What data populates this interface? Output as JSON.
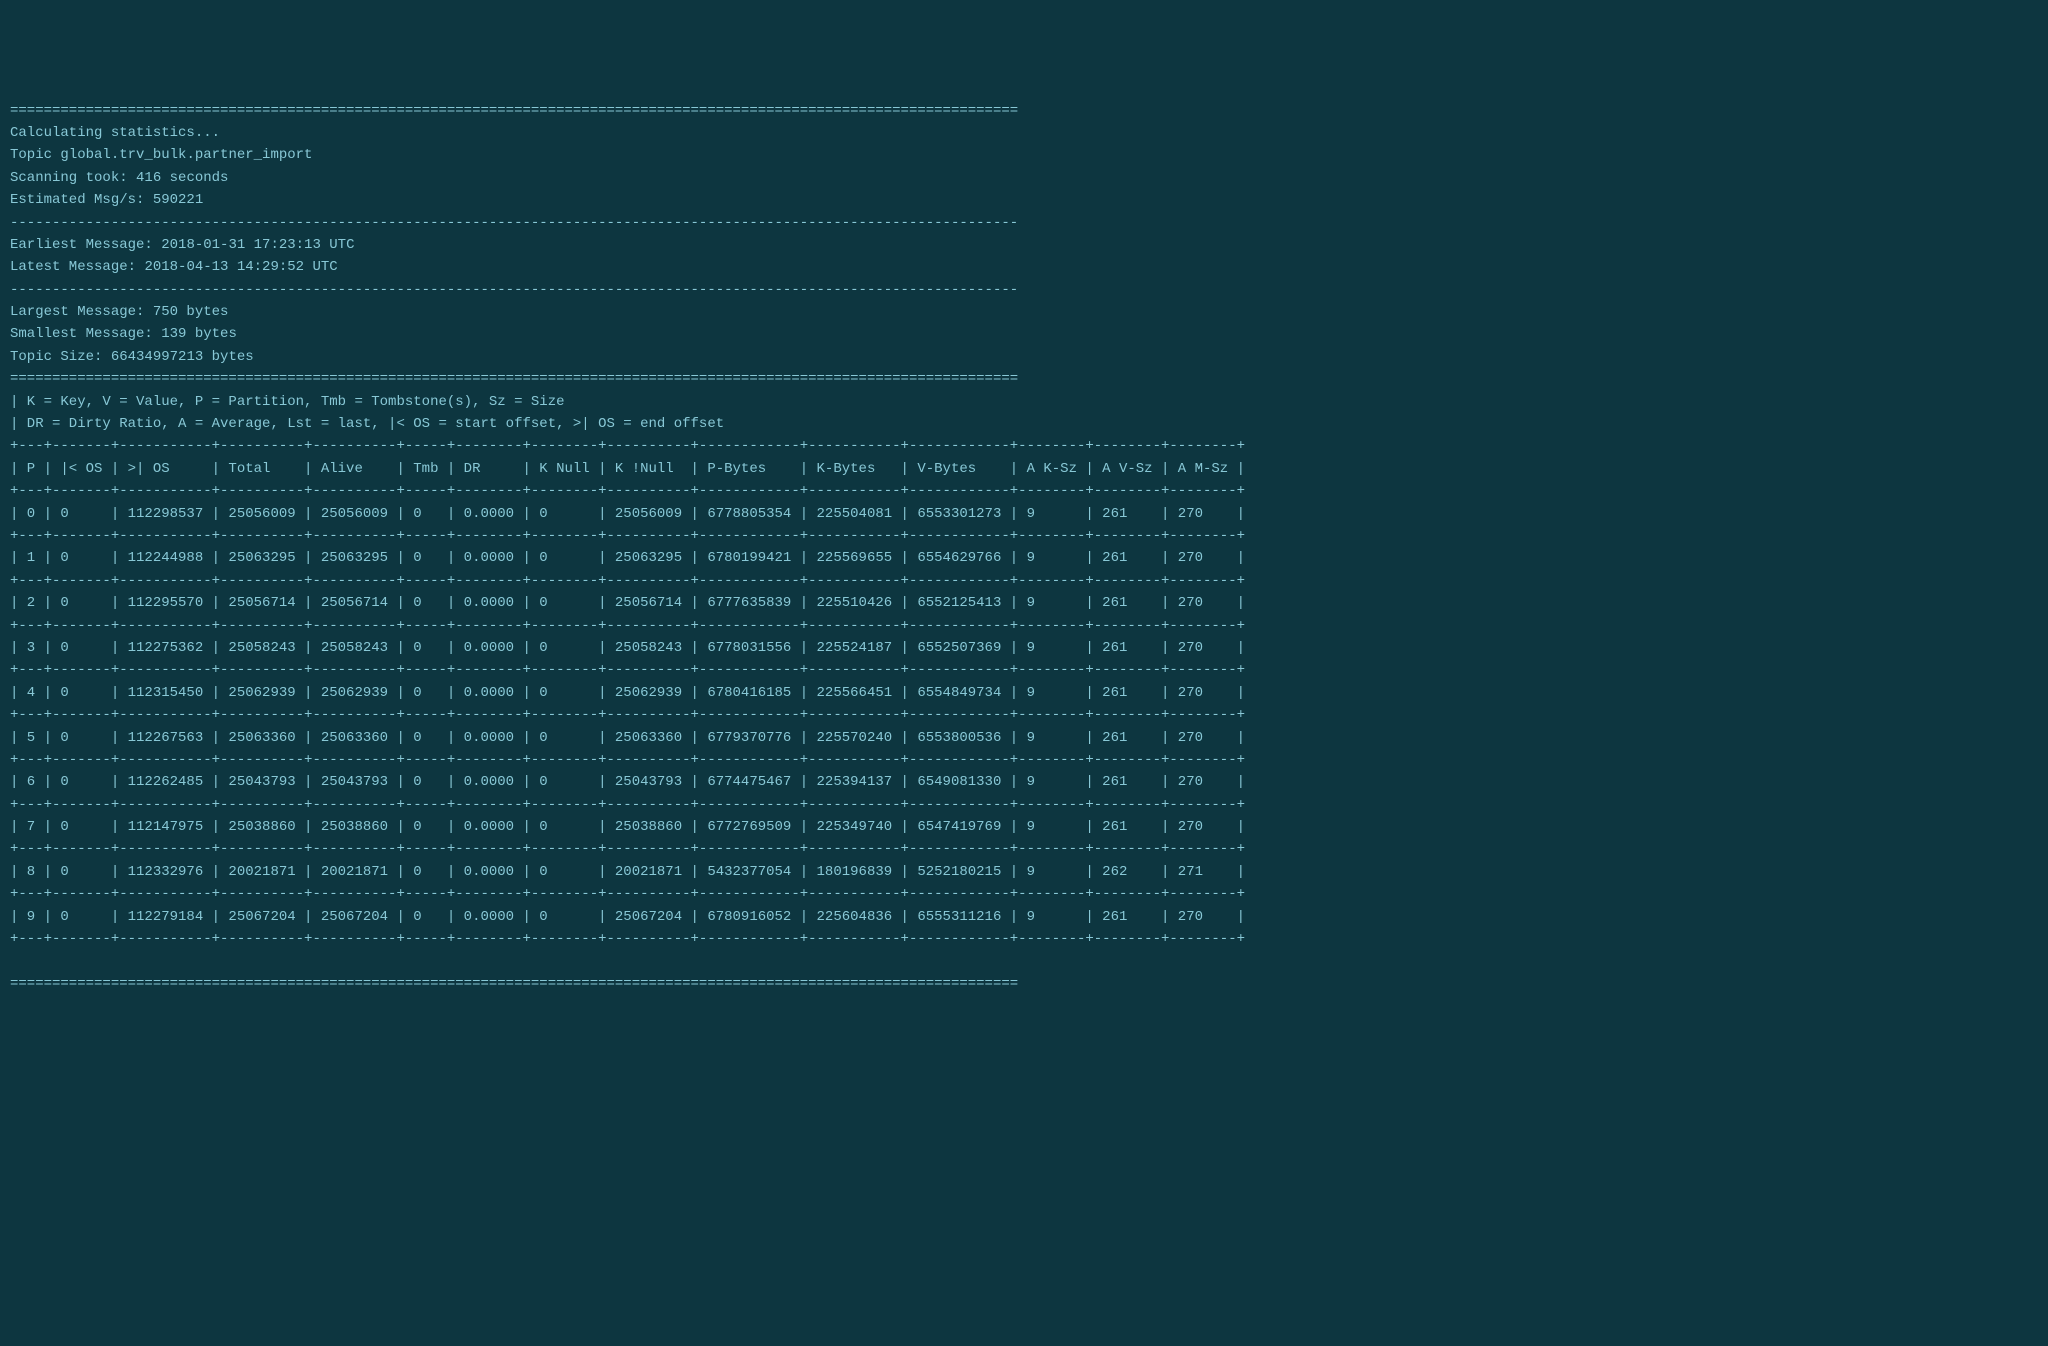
{
  "header": {
    "calculating": "Calculating statistics...",
    "topic_label": "Topic",
    "topic_name": "global.trv_bulk.partner_import",
    "scanning_label": "Scanning took:",
    "scanning_value": "416 seconds",
    "msgps_label": "Estimated Msg/s:",
    "msgps_value": "590221",
    "earliest_label": "Earliest Message:",
    "earliest_value": "2018-01-31 17:23:13 UTC",
    "latest_label": "Latest Message:",
    "latest_value": "2018-04-13 14:29:52 UTC",
    "largest_label": "Largest Message:",
    "largest_value": "750 bytes",
    "smallest_label": "Smallest Message:",
    "smallest_value": "139 bytes",
    "topic_size_label": "Topic Size:",
    "topic_size_value": "66434997213 bytes"
  },
  "legend": {
    "line1": "| K = Key, V = Value, P = Partition, Tmb = Tombstone(s), Sz = Size",
    "line2": "| DR = Dirty Ratio, A = Average, Lst = last, |< OS = start offset, >| OS = end offset"
  },
  "table": {
    "headers": {
      "p": "P",
      "start_os": "|< OS",
      "end_os": ">| OS",
      "total": "Total",
      "alive": "Alive",
      "tmb": "Tmb",
      "dr": "DR",
      "k_null": "K Null",
      "k_not_null": "K !Null",
      "p_bytes": "P-Bytes",
      "k_bytes": "K-Bytes",
      "v_bytes": "V-Bytes",
      "a_ksz": "A K-Sz",
      "a_vsz": "A V-Sz",
      "a_msz": "A M-Sz"
    },
    "rows": [
      {
        "p": "0",
        "start_os": "0",
        "end_os": "112298537",
        "total": "25056009",
        "alive": "25056009",
        "tmb": "0",
        "dr": "0.0000",
        "k_null": "0",
        "k_not_null": "25056009",
        "p_bytes": "6778805354",
        "k_bytes": "225504081",
        "v_bytes": "6553301273",
        "a_ksz": "9",
        "a_vsz": "261",
        "a_msz": "270"
      },
      {
        "p": "1",
        "start_os": "0",
        "end_os": "112244988",
        "total": "25063295",
        "alive": "25063295",
        "tmb": "0",
        "dr": "0.0000",
        "k_null": "0",
        "k_not_null": "25063295",
        "p_bytes": "6780199421",
        "k_bytes": "225569655",
        "v_bytes": "6554629766",
        "a_ksz": "9",
        "a_vsz": "261",
        "a_msz": "270"
      },
      {
        "p": "2",
        "start_os": "0",
        "end_os": "112295570",
        "total": "25056714",
        "alive": "25056714",
        "tmb": "0",
        "dr": "0.0000",
        "k_null": "0",
        "k_not_null": "25056714",
        "p_bytes": "6777635839",
        "k_bytes": "225510426",
        "v_bytes": "6552125413",
        "a_ksz": "9",
        "a_vsz": "261",
        "a_msz": "270"
      },
      {
        "p": "3",
        "start_os": "0",
        "end_os": "112275362",
        "total": "25058243",
        "alive": "25058243",
        "tmb": "0",
        "dr": "0.0000",
        "k_null": "0",
        "k_not_null": "25058243",
        "p_bytes": "6778031556",
        "k_bytes": "225524187",
        "v_bytes": "6552507369",
        "a_ksz": "9",
        "a_vsz": "261",
        "a_msz": "270"
      },
      {
        "p": "4",
        "start_os": "0",
        "end_os": "112315450",
        "total": "25062939",
        "alive": "25062939",
        "tmb": "0",
        "dr": "0.0000",
        "k_null": "0",
        "k_not_null": "25062939",
        "p_bytes": "6780416185",
        "k_bytes": "225566451",
        "v_bytes": "6554849734",
        "a_ksz": "9",
        "a_vsz": "261",
        "a_msz": "270"
      },
      {
        "p": "5",
        "start_os": "0",
        "end_os": "112267563",
        "total": "25063360",
        "alive": "25063360",
        "tmb": "0",
        "dr": "0.0000",
        "k_null": "0",
        "k_not_null": "25063360",
        "p_bytes": "6779370776",
        "k_bytes": "225570240",
        "v_bytes": "6553800536",
        "a_ksz": "9",
        "a_vsz": "261",
        "a_msz": "270"
      },
      {
        "p": "6",
        "start_os": "0",
        "end_os": "112262485",
        "total": "25043793",
        "alive": "25043793",
        "tmb": "0",
        "dr": "0.0000",
        "k_null": "0",
        "k_not_null": "25043793",
        "p_bytes": "6774475467",
        "k_bytes": "225394137",
        "v_bytes": "6549081330",
        "a_ksz": "9",
        "a_vsz": "261",
        "a_msz": "270"
      },
      {
        "p": "7",
        "start_os": "0",
        "end_os": "112147975",
        "total": "25038860",
        "alive": "25038860",
        "tmb": "0",
        "dr": "0.0000",
        "k_null": "0",
        "k_not_null": "25038860",
        "p_bytes": "6772769509",
        "k_bytes": "225349740",
        "v_bytes": "6547419769",
        "a_ksz": "9",
        "a_vsz": "261",
        "a_msz": "270"
      },
      {
        "p": "8",
        "start_os": "0",
        "end_os": "112332976",
        "total": "20021871",
        "alive": "20021871",
        "tmb": "0",
        "dr": "0.0000",
        "k_null": "0",
        "k_not_null": "20021871",
        "p_bytes": "5432377054",
        "k_bytes": "180196839",
        "v_bytes": "5252180215",
        "a_ksz": "9",
        "a_vsz": "262",
        "a_msz": "271"
      },
      {
        "p": "9",
        "start_os": "0",
        "end_os": "112279184",
        "total": "25067204",
        "alive": "25067204",
        "tmb": "0",
        "dr": "0.0000",
        "k_null": "0",
        "k_not_null": "25067204",
        "p_bytes": "6780916052",
        "k_bytes": "225604836",
        "v_bytes": "6555311216",
        "a_ksz": "9",
        "a_vsz": "261",
        "a_msz": "270"
      }
    ]
  },
  "dividers": {
    "double": "========================================================================================================================",
    "single": "------------------------------------------------------------------------------------------------------------------------",
    "table_sep": "+---+-------+-----------+----------+----------+-----+--------+--------+----------+------------+-----------+------------+--------+--------+--------+"
  }
}
